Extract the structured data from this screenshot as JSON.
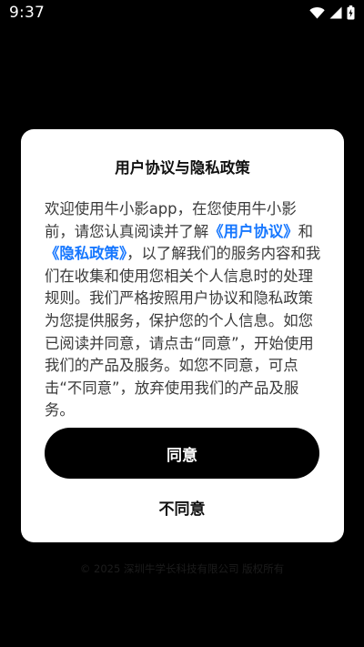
{
  "status_bar": {
    "time": "9:37",
    "icons": [
      "wifi-icon",
      "cell-signal-icon",
      "battery-charging-icon"
    ]
  },
  "dialog": {
    "title": "用户协议与隐私政策",
    "body": {
      "intro": "欢迎使用牛小影app，在您使用牛小影前，请您认真阅读并了解",
      "user_agreement_link": "《用户协议》",
      "connector": "和",
      "privacy_policy_link": "《隐私政策》",
      "rest": "，以了解我们的服务内容和我们在收集和使用您相关个人信息时的处理规则。我们严格按照用户协议和隐私政策为您提供服务，保护您的个人信息。如您已阅读并同意，请点击“同意”，开始使用我们的产品及服务。如您不同意，可点击“不同意”，放弃使用我们的产品及服务。"
    },
    "agree_label": "同意",
    "disagree_label": "不同意"
  },
  "footer": {
    "copyright": "© 2025 深圳牛学长科技有限公司 版权所有"
  },
  "colors": {
    "background": "#000000",
    "dialog": "#ffffff",
    "link": "#1677ff",
    "primary_button": "#000000"
  }
}
